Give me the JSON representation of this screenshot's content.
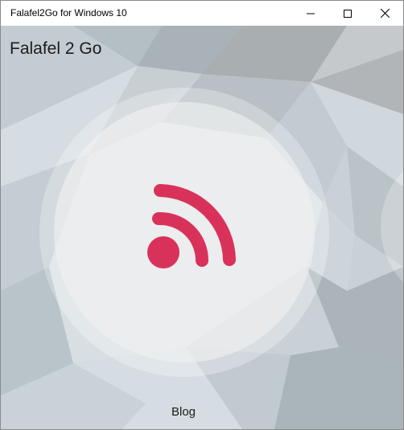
{
  "window": {
    "title": "Falafel2Go for Windows 10"
  },
  "app": {
    "title": "Falafel 2 Go"
  },
  "tiles": [
    {
      "label": "Blog",
      "icon": "rss-icon"
    }
  ],
  "colors": {
    "accent": "#d9325a"
  }
}
